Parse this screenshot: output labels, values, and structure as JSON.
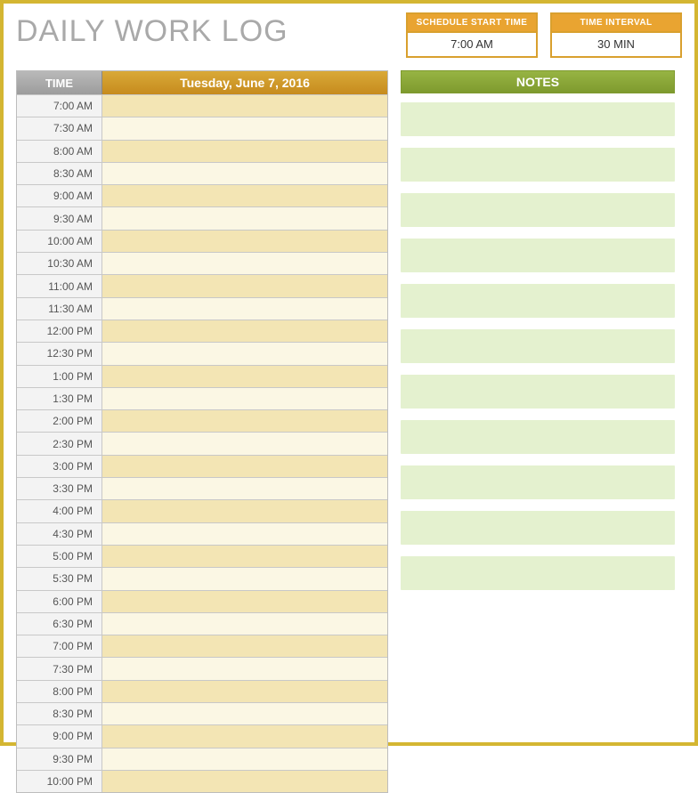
{
  "title": "DAILY WORK LOG",
  "meta": {
    "start_label": "SCHEDULE START TIME",
    "start_value": "7:00 AM",
    "interval_label": "TIME INTERVAL",
    "interval_value": "30 MIN"
  },
  "schedule": {
    "time_header": "TIME",
    "date_header": "Tuesday, June 7, 2016",
    "rows": [
      {
        "time": "7:00 AM",
        "on": true
      },
      {
        "time": "7:30 AM",
        "on": false
      },
      {
        "time": "8:00 AM",
        "on": true
      },
      {
        "time": "8:30 AM",
        "on": false
      },
      {
        "time": "9:00 AM",
        "on": true
      },
      {
        "time": "9:30 AM",
        "on": false
      },
      {
        "time": "10:00 AM",
        "on": true
      },
      {
        "time": "10:30 AM",
        "on": false
      },
      {
        "time": "11:00 AM",
        "on": true
      },
      {
        "time": "11:30 AM",
        "on": false
      },
      {
        "time": "12:00 PM",
        "on": true
      },
      {
        "time": "12:30 PM",
        "on": false
      },
      {
        "time": "1:00 PM",
        "on": true
      },
      {
        "time": "1:30 PM",
        "on": false
      },
      {
        "time": "2:00 PM",
        "on": true
      },
      {
        "time": "2:30 PM",
        "on": false
      },
      {
        "time": "3:00 PM",
        "on": true
      },
      {
        "time": "3:30 PM",
        "on": false
      },
      {
        "time": "4:00 PM",
        "on": true
      },
      {
        "time": "4:30 PM",
        "on": false
      },
      {
        "time": "5:00 PM",
        "on": true
      },
      {
        "time": "5:30 PM",
        "on": false
      },
      {
        "time": "6:00 PM",
        "on": true
      },
      {
        "time": "6:30 PM",
        "on": false
      },
      {
        "time": "7:00 PM",
        "on": true
      },
      {
        "time": "7:30 PM",
        "on": false
      },
      {
        "time": "8:00 PM",
        "on": true
      },
      {
        "time": "8:30 PM",
        "on": false
      },
      {
        "time": "9:00 PM",
        "on": true
      },
      {
        "time": "9:30 PM",
        "on": false
      },
      {
        "time": "10:00 PM",
        "on": true
      }
    ]
  },
  "notes": {
    "header": "NOTES",
    "blocks_count": 11
  }
}
